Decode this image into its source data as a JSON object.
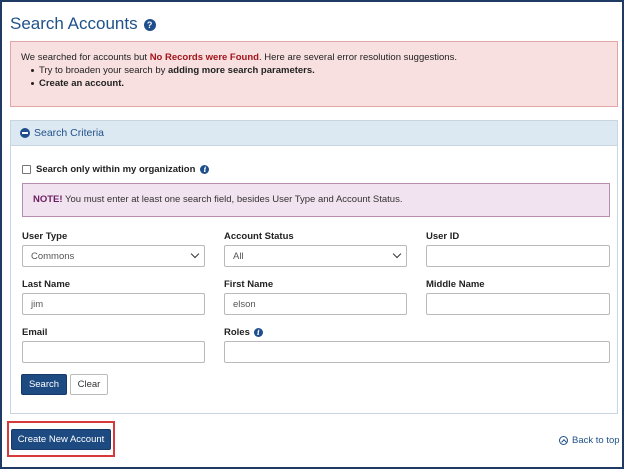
{
  "page": {
    "title": "Search Accounts"
  },
  "alert": {
    "intro_before": "We searched for accounts but ",
    "intro_highlight": "No Records were Found",
    "intro_after": ". Here are several error resolution suggestions.",
    "suggestion1_before": "Try to broaden your search by ",
    "suggestion1_bold": "adding more search parameters.",
    "suggestion2": "Create an account."
  },
  "criteria": {
    "header": "Search Criteria",
    "org_only_label": "Search only within my organization",
    "org_only_checked": false,
    "note_label": "NOTE!",
    "note_text": " You must enter at least one search field, besides User Type and Account Status."
  },
  "fields": {
    "user_type": {
      "label": "User Type",
      "value": "Commons"
    },
    "account_status": {
      "label": "Account Status",
      "value": "All"
    },
    "user_id": {
      "label": "User ID",
      "value": ""
    },
    "last_name": {
      "label": "Last Name",
      "value": "jim"
    },
    "first_name": {
      "label": "First Name",
      "value": "elson"
    },
    "middle_name": {
      "label": "Middle Name",
      "value": ""
    },
    "email": {
      "label": "Email",
      "value": ""
    },
    "roles": {
      "label": "Roles",
      "value": ""
    }
  },
  "buttons": {
    "search": "Search",
    "clear": "Clear",
    "create_new": "Create New Account",
    "back_to_top": "Back to top"
  },
  "colors": {
    "primary": "#1e4a82",
    "alert_bg": "#f8e0e0",
    "note_bg": "#f1e3ef",
    "highlight_border": "#d63a3a"
  }
}
